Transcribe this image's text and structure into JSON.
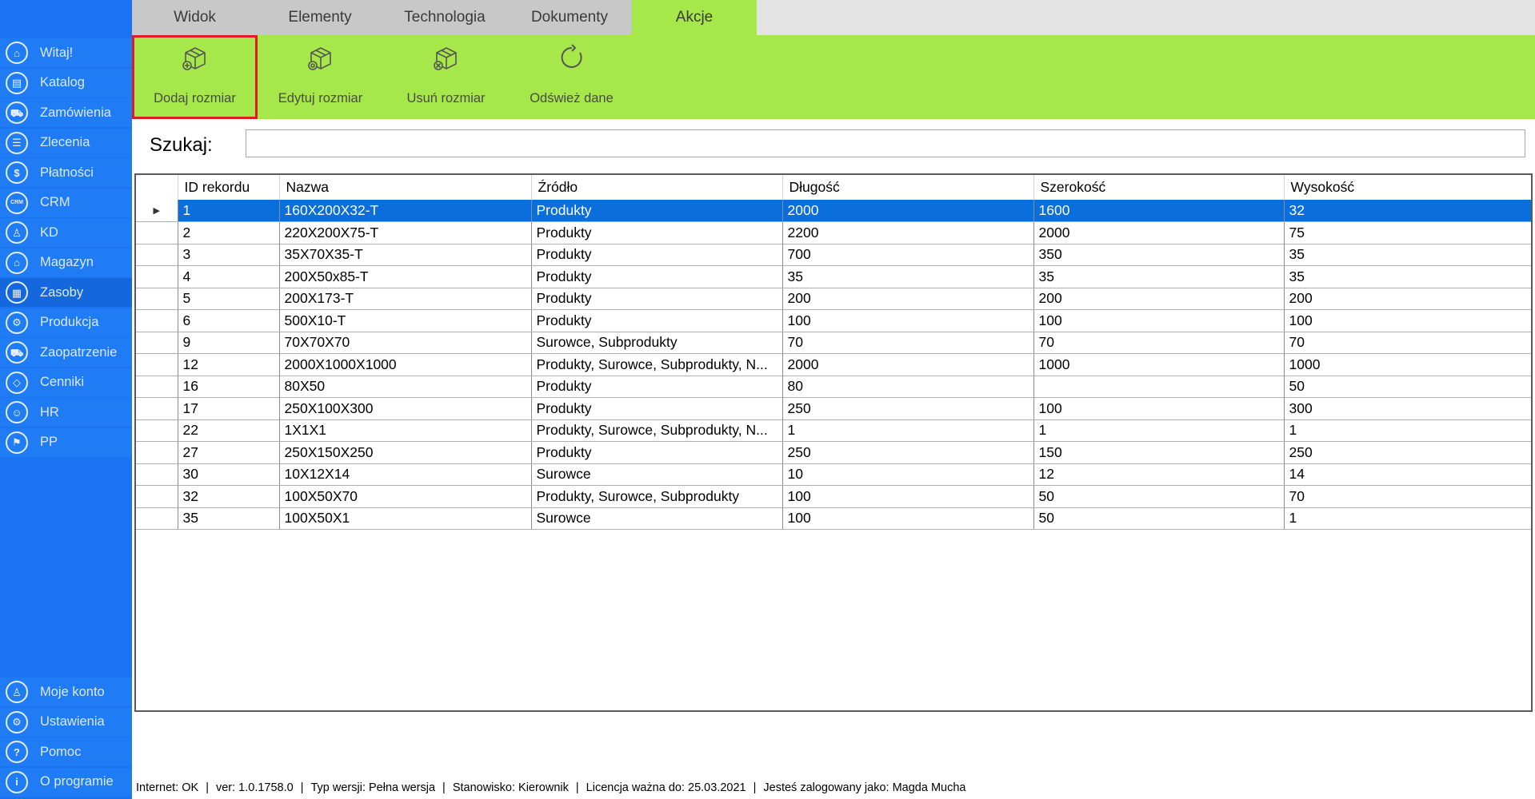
{
  "sidebar": {
    "top_items": [
      {
        "label": "Witaj!",
        "icon": "home-icon",
        "glyph": "⌂"
      },
      {
        "label": "Katalog",
        "icon": "book-icon",
        "glyph": "▤"
      },
      {
        "label": "Zamówienia",
        "icon": "cart-icon",
        "glyph": "⛟"
      },
      {
        "label": "Zlecenia",
        "icon": "list-icon",
        "glyph": "☰"
      },
      {
        "label": "Płatności",
        "icon": "dollar-icon",
        "glyph": "$"
      },
      {
        "label": "CRM",
        "icon": "crm-icon",
        "glyph": "CRM"
      },
      {
        "label": "KD",
        "icon": "user-icon",
        "glyph": "♙"
      },
      {
        "label": "Magazyn",
        "icon": "warehouse-icon",
        "glyph": "⌂"
      },
      {
        "label": "Zasoby",
        "icon": "resources-icon",
        "glyph": "▦"
      },
      {
        "label": "Produkcja",
        "icon": "production-icon",
        "glyph": "⚙"
      },
      {
        "label": "Zaopatrzenie",
        "icon": "truck-icon",
        "glyph": "⛟"
      },
      {
        "label": "Cenniki",
        "icon": "tag-icon",
        "glyph": "◇"
      },
      {
        "label": "HR",
        "icon": "hr-icon",
        "glyph": "☺"
      },
      {
        "label": "PP",
        "icon": "pp-icon",
        "glyph": "⚑"
      }
    ],
    "bottom_items": [
      {
        "label": "Moje konto",
        "icon": "account-icon",
        "glyph": "♙"
      },
      {
        "label": "Ustawienia",
        "icon": "settings-icon",
        "glyph": "⚙"
      },
      {
        "label": "Pomoc",
        "icon": "help-icon",
        "glyph": "?"
      },
      {
        "label": "O programie",
        "icon": "info-icon",
        "glyph": "i"
      }
    ],
    "active_label": "Zasoby"
  },
  "tabs": [
    {
      "label": "Widok"
    },
    {
      "label": "Elementy"
    },
    {
      "label": "Technologia"
    },
    {
      "label": "Dokumenty"
    },
    {
      "label": "Akcje"
    }
  ],
  "active_tab": "Akcje",
  "ribbon": {
    "add_label": "Dodaj rozmiar",
    "edit_label": "Edytuj rozmiar",
    "delete_label": "Usuń rozmiar",
    "refresh_label": "Odśwież dane"
  },
  "search": {
    "label": "Szukaj:",
    "value": ""
  },
  "grid": {
    "columns": [
      "ID rekordu",
      "Nazwa",
      "Źródło",
      "Długość",
      "Szerokość",
      "Wysokość"
    ],
    "selected_row": 0,
    "rows": [
      [
        "1",
        "160X200X32-T",
        "Produkty",
        "2000",
        "1600",
        "32"
      ],
      [
        "2",
        "220X200X75-T",
        "Produkty",
        "2200",
        "2000",
        "75"
      ],
      [
        "3",
        "35X70X35-T",
        "Produkty",
        "700",
        "350",
        "35"
      ],
      [
        "4",
        "200X50x85-T",
        "Produkty",
        "35",
        "35",
        "35"
      ],
      [
        "5",
        "200X173-T",
        "Produkty",
        "200",
        "200",
        "200"
      ],
      [
        "6",
        "500X10-T",
        "Produkty",
        "100",
        "100",
        "100"
      ],
      [
        "9",
        "70X70X70",
        "Surowce, Subprodukty",
        "70",
        "70",
        "70"
      ],
      [
        "12",
        "2000X1000X1000",
        "Produkty, Surowce, Subprodukty, N...",
        "2000",
        "1000",
        "1000"
      ],
      [
        "16",
        "80X50",
        "Produkty",
        "80",
        "",
        "50"
      ],
      [
        "17",
        "250X100X300",
        "Produkty",
        "250",
        "100",
        "300"
      ],
      [
        "22",
        "1X1X1",
        "Produkty, Surowce, Subprodukty, N...",
        "1",
        "1",
        "1"
      ],
      [
        "27",
        "250X150X250",
        "Produkty",
        "250",
        "150",
        "250"
      ],
      [
        "30",
        "10X12X14",
        "Surowce",
        "10",
        "12",
        "14"
      ],
      [
        "32",
        "100X50X70",
        "Produkty, Surowce, Subprodukty",
        "100",
        "50",
        "70"
      ],
      [
        "35",
        "100X50X1",
        "Surowce",
        "100",
        "50",
        "1"
      ]
    ]
  },
  "status": {
    "internet": "Internet: OK",
    "version": "ver: 1.0.1758.0",
    "edition": "Typ wersji: Pełna wersja",
    "station": "Stanowisko: Kierownik",
    "license": "Licencja ważna do: 25.03.2021",
    "user": "Jesteś zalogowany jako: Magda Mucha"
  },
  "colors": {
    "sidebar": "#1a73f0",
    "ribbon": "#a6e84a",
    "selection": "#0a6fdc",
    "highlight_border": "#e01b24"
  }
}
